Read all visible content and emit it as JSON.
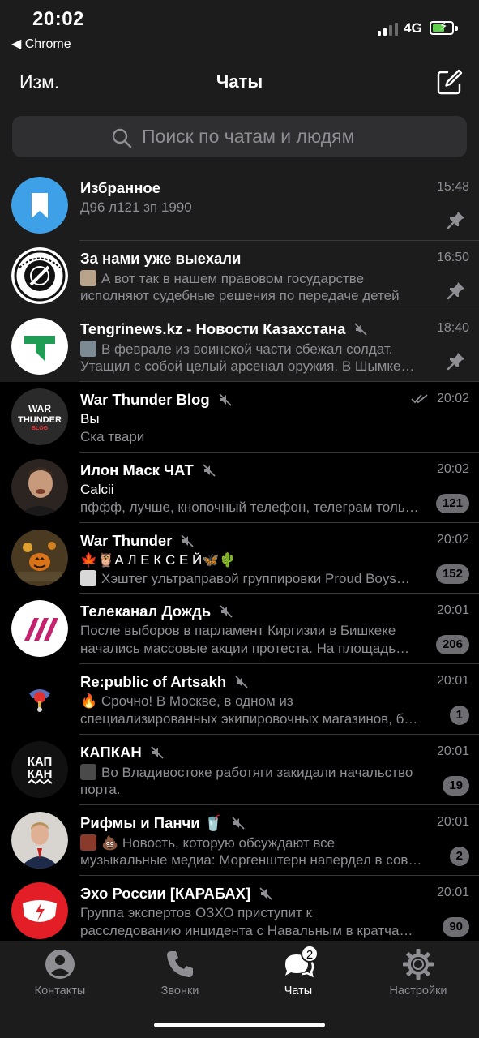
{
  "status_bar": {
    "time": "20:02",
    "back_app": "◀ Chrome",
    "network": "4G"
  },
  "nav": {
    "edit_label": "Изм.",
    "title": "Чаты"
  },
  "search": {
    "placeholder": "Поиск по чатам и людям"
  },
  "chats": [
    {
      "name": "Избранное",
      "time": "15:48",
      "line1": "Д96 л121 зп 1990",
      "line2": "",
      "pinned": true
    },
    {
      "name": "За нами уже выехали",
      "time": "16:50",
      "line1": "А вот так в нашем правовом государстве",
      "line2": "исполняют судебные решения по передаче детей",
      "pinned": true
    },
    {
      "name": "Tengrinews.kz - Новости Казахстана",
      "time": "18:40",
      "line1": "В феврале из воинской части сбежал солдат.",
      "line2": "Утащил с собой целый арсенал оружия.  В Шымке…",
      "pinned": true
    },
    {
      "name": "War Thunder Blog",
      "time": "20:02",
      "sender": "Вы",
      "line2": "Ска твари"
    },
    {
      "name": "Илон Маск ЧАТ",
      "time": "20:02",
      "sender": "Calcii",
      "line2": "пффф, лучше, кнопочный телефон, телеграм толь…",
      "badge": "121"
    },
    {
      "name": "War Thunder",
      "time": "20:02",
      "sender": "🍁🦉А Л Е К С Е Й🦋🌵",
      "line2": "Хэштег ультраправой группировки Proud Boys…",
      "badge": "152"
    },
    {
      "name": "Телеканал Дождь",
      "time": "20:01",
      "line1": "После выборов в парламент Киргизии в Бишкеке",
      "line2": "начались массовые акции протеста. На площадь…",
      "badge": "206"
    },
    {
      "name": "Re:public of Artsakh",
      "time": "20:01",
      "line1": "🔥 Срочно!  В Москве, в одном из",
      "line2": "специализированных экипировочных магазинов, б…",
      "badge": "1"
    },
    {
      "name": "КАПКАН",
      "time": "20:01",
      "line1": "Во Владивостоке работяги закидали начальство",
      "line2": "порта.",
      "badge": "19"
    },
    {
      "name": "Рифмы и Панчи 🥤",
      "time": "20:01",
      "line1": "💩 Новость, которую обсуждают все",
      "line2": "музыкальные медиа: Моргенштерн напердел в сов…",
      "badge": "2"
    },
    {
      "name": "Эхо России [КАРАБАХ]",
      "time": "20:01",
      "line1": "Группа экспертов ОЗХО приступит к",
      "line2": "расследованию инцидента с Навальным в кратча…",
      "badge": "90"
    }
  ],
  "avatars": {
    "war_thunder_blog_text": [
      "WAR",
      "THUNDER",
      "BLOG"
    ],
    "kapkan_text": [
      "КАП",
      "КАН"
    ]
  },
  "tabs": [
    {
      "label": "Контакты",
      "icon": "person-circle-icon"
    },
    {
      "label": "Звонки",
      "icon": "phone-icon"
    },
    {
      "label": "Чаты",
      "icon": "chat-bubbles-icon",
      "badge": "2",
      "active": true
    },
    {
      "label": "Настройки",
      "icon": "gear-icon"
    }
  ],
  "colors": {
    "background": "#000000",
    "pinned_background": "#1c1c1d",
    "secondary_text": "#8e8e93",
    "badge": "#8e8e93",
    "saved_messages": "#3ea1e8",
    "dozhd": "#c4216e",
    "echo_red": "#e41e26"
  }
}
